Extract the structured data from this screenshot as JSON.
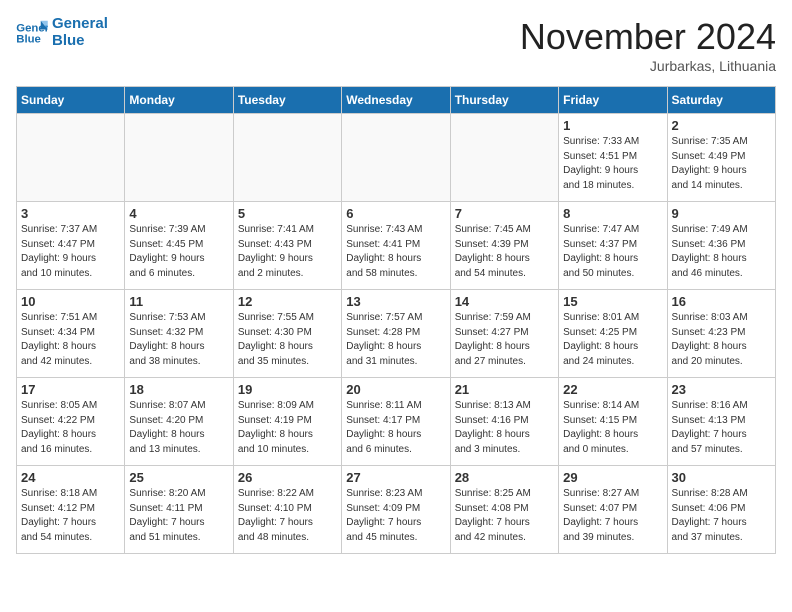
{
  "logo": {
    "line1": "General",
    "line2": "Blue"
  },
  "title": "November 2024",
  "location": "Jurbarkas, Lithuania",
  "weekdays": [
    "Sunday",
    "Monday",
    "Tuesday",
    "Wednesday",
    "Thursday",
    "Friday",
    "Saturday"
  ],
  "weeks": [
    [
      {
        "day": "",
        "info": ""
      },
      {
        "day": "",
        "info": ""
      },
      {
        "day": "",
        "info": ""
      },
      {
        "day": "",
        "info": ""
      },
      {
        "day": "",
        "info": ""
      },
      {
        "day": "1",
        "info": "Sunrise: 7:33 AM\nSunset: 4:51 PM\nDaylight: 9 hours\nand 18 minutes."
      },
      {
        "day": "2",
        "info": "Sunrise: 7:35 AM\nSunset: 4:49 PM\nDaylight: 9 hours\nand 14 minutes."
      }
    ],
    [
      {
        "day": "3",
        "info": "Sunrise: 7:37 AM\nSunset: 4:47 PM\nDaylight: 9 hours\nand 10 minutes."
      },
      {
        "day": "4",
        "info": "Sunrise: 7:39 AM\nSunset: 4:45 PM\nDaylight: 9 hours\nand 6 minutes."
      },
      {
        "day": "5",
        "info": "Sunrise: 7:41 AM\nSunset: 4:43 PM\nDaylight: 9 hours\nand 2 minutes."
      },
      {
        "day": "6",
        "info": "Sunrise: 7:43 AM\nSunset: 4:41 PM\nDaylight: 8 hours\nand 58 minutes."
      },
      {
        "day": "7",
        "info": "Sunrise: 7:45 AM\nSunset: 4:39 PM\nDaylight: 8 hours\nand 54 minutes."
      },
      {
        "day": "8",
        "info": "Sunrise: 7:47 AM\nSunset: 4:37 PM\nDaylight: 8 hours\nand 50 minutes."
      },
      {
        "day": "9",
        "info": "Sunrise: 7:49 AM\nSunset: 4:36 PM\nDaylight: 8 hours\nand 46 minutes."
      }
    ],
    [
      {
        "day": "10",
        "info": "Sunrise: 7:51 AM\nSunset: 4:34 PM\nDaylight: 8 hours\nand 42 minutes."
      },
      {
        "day": "11",
        "info": "Sunrise: 7:53 AM\nSunset: 4:32 PM\nDaylight: 8 hours\nand 38 minutes."
      },
      {
        "day": "12",
        "info": "Sunrise: 7:55 AM\nSunset: 4:30 PM\nDaylight: 8 hours\nand 35 minutes."
      },
      {
        "day": "13",
        "info": "Sunrise: 7:57 AM\nSunset: 4:28 PM\nDaylight: 8 hours\nand 31 minutes."
      },
      {
        "day": "14",
        "info": "Sunrise: 7:59 AM\nSunset: 4:27 PM\nDaylight: 8 hours\nand 27 minutes."
      },
      {
        "day": "15",
        "info": "Sunrise: 8:01 AM\nSunset: 4:25 PM\nDaylight: 8 hours\nand 24 minutes."
      },
      {
        "day": "16",
        "info": "Sunrise: 8:03 AM\nSunset: 4:23 PM\nDaylight: 8 hours\nand 20 minutes."
      }
    ],
    [
      {
        "day": "17",
        "info": "Sunrise: 8:05 AM\nSunset: 4:22 PM\nDaylight: 8 hours\nand 16 minutes."
      },
      {
        "day": "18",
        "info": "Sunrise: 8:07 AM\nSunset: 4:20 PM\nDaylight: 8 hours\nand 13 minutes."
      },
      {
        "day": "19",
        "info": "Sunrise: 8:09 AM\nSunset: 4:19 PM\nDaylight: 8 hours\nand 10 minutes."
      },
      {
        "day": "20",
        "info": "Sunrise: 8:11 AM\nSunset: 4:17 PM\nDaylight: 8 hours\nand 6 minutes."
      },
      {
        "day": "21",
        "info": "Sunrise: 8:13 AM\nSunset: 4:16 PM\nDaylight: 8 hours\nand 3 minutes."
      },
      {
        "day": "22",
        "info": "Sunrise: 8:14 AM\nSunset: 4:15 PM\nDaylight: 8 hours\nand 0 minutes."
      },
      {
        "day": "23",
        "info": "Sunrise: 8:16 AM\nSunset: 4:13 PM\nDaylight: 7 hours\nand 57 minutes."
      }
    ],
    [
      {
        "day": "24",
        "info": "Sunrise: 8:18 AM\nSunset: 4:12 PM\nDaylight: 7 hours\nand 54 minutes."
      },
      {
        "day": "25",
        "info": "Sunrise: 8:20 AM\nSunset: 4:11 PM\nDaylight: 7 hours\nand 51 minutes."
      },
      {
        "day": "26",
        "info": "Sunrise: 8:22 AM\nSunset: 4:10 PM\nDaylight: 7 hours\nand 48 minutes."
      },
      {
        "day": "27",
        "info": "Sunrise: 8:23 AM\nSunset: 4:09 PM\nDaylight: 7 hours\nand 45 minutes."
      },
      {
        "day": "28",
        "info": "Sunrise: 8:25 AM\nSunset: 4:08 PM\nDaylight: 7 hours\nand 42 minutes."
      },
      {
        "day": "29",
        "info": "Sunrise: 8:27 AM\nSunset: 4:07 PM\nDaylight: 7 hours\nand 39 minutes."
      },
      {
        "day": "30",
        "info": "Sunrise: 8:28 AM\nSunset: 4:06 PM\nDaylight: 7 hours\nand 37 minutes."
      }
    ]
  ]
}
